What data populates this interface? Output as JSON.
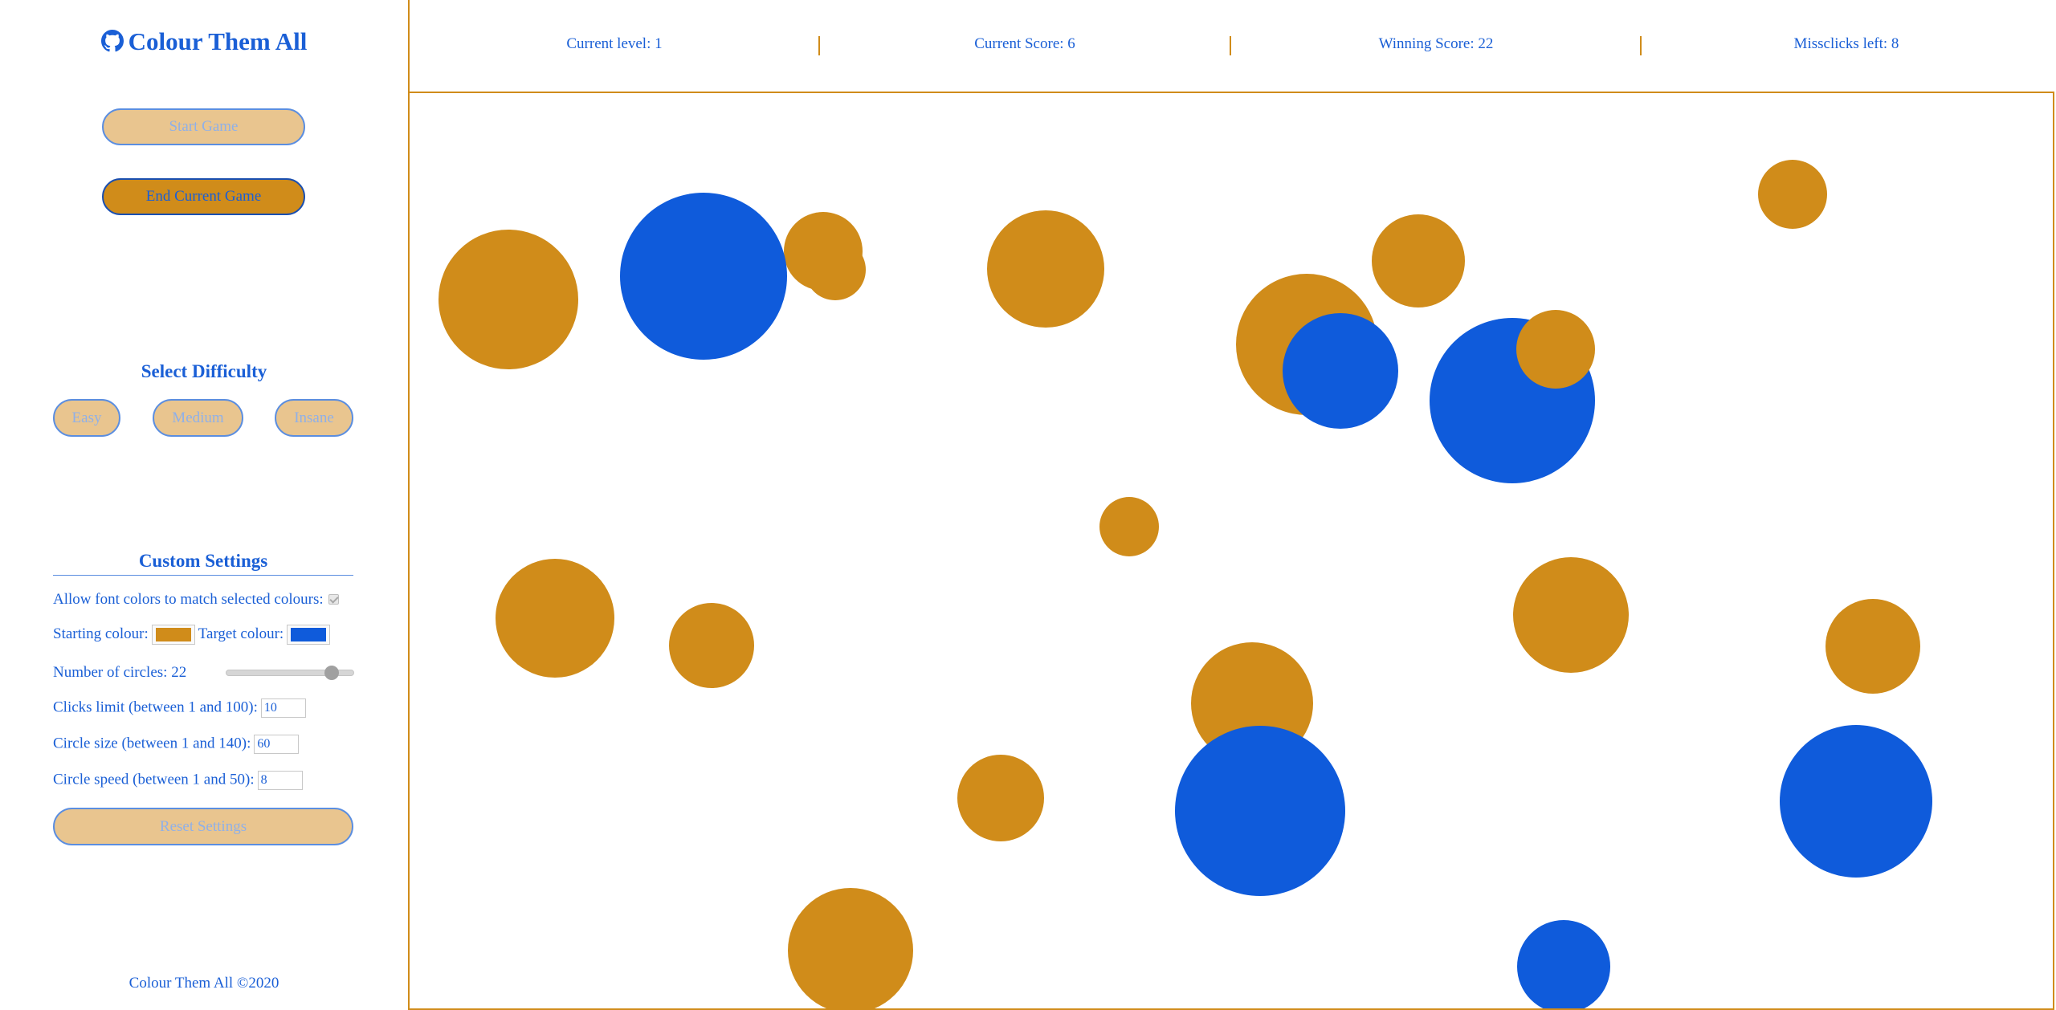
{
  "app": {
    "title": "Colour Them All",
    "footer": "Colour Them All ©2020"
  },
  "buttons": {
    "start": "Start Game",
    "end": "End Current Game"
  },
  "difficulty": {
    "heading": "Select Difficulty",
    "easy": "Easy",
    "medium": "Medium",
    "insane": "Insane"
  },
  "settings": {
    "heading": "Custom Settings",
    "font_colors_label": "Allow font colors to match selected colours:",
    "font_colors_checked": true,
    "starting_colour_label": "Starting colour:",
    "starting_colour": "#d08c1a",
    "target_colour_label": "Target colour:",
    "target_colour": "#0f5bdb",
    "circles_label": "Number of circles: 22",
    "circles_value": 22,
    "clicks_label": "Clicks limit (between 1 and 100):",
    "clicks_value": "10",
    "size_label": "Circle size (between 1 and 140):",
    "size_value": "60",
    "speed_label": "Circle speed (between 1 and 50):",
    "speed_value": "8",
    "reset": "Reset Settings"
  },
  "stats": {
    "level": "Current level: 1",
    "score": "Current Score: 6",
    "winning": "Winning Score: 22",
    "misclicks": "Missclicks left: 8"
  },
  "colors": {
    "starting": "#d08c1a",
    "target": "#0f5bdb",
    "accent_text": "#1a5fd6"
  }
}
